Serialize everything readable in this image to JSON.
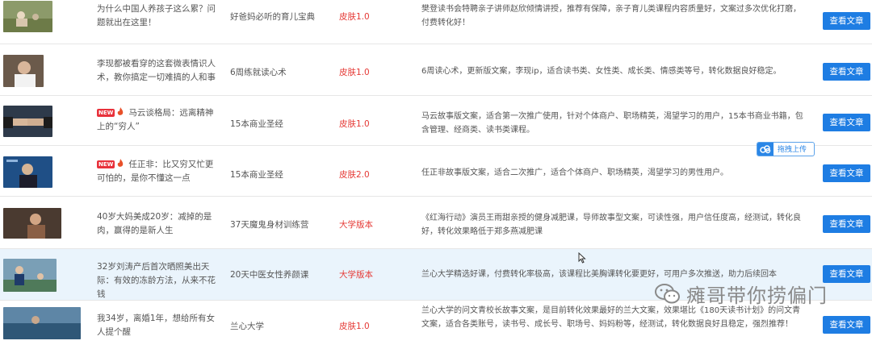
{
  "button_label": "查看文章",
  "upload_label": "拖拽上传",
  "watermark": "瘫哥带你捞偏门",
  "new_badge": "NEW",
  "rows": [
    {
      "title": "为什么中国人养孩子这么累？问题就出在这里！",
      "course": "好爸妈必听的育儿宝典",
      "skin": "皮肤1.0",
      "desc": "樊登读书会特聘亲子讲师赵欣倾情讲授，推荐有保障，亲子育儿类课程内容质量好，文案过多次优化打磨，付费转化好！"
    },
    {
      "title": "李现都被看穿的这套微表情识人术，教你搞定一切难搞的人和事",
      "course": "6周练就读心术",
      "skin": "皮肤1.0",
      "desc": "6周读心术，更新版文案，李现ip，适合读书类、女性类、成长类、情感类等号，转化数据良好稳定。"
    },
    {
      "title": "马云谈格局：远离精神上的“穷人”",
      "course": "15本商业圣经",
      "skin": "皮肤1.0",
      "desc": "马云故事版文案，适合第一次推广使用，针对个体商户、职场精英，渴望学习的用户，15本书商业书籍，包含管理、经商类、读书类课程。"
    },
    {
      "title": "任正非：比又穷又忙更可怕的，是你不懂这一点",
      "course": "15本商业圣经",
      "skin": "皮肤2.0",
      "desc": "任正非故事版文案，适合二次推广，适合个体商户、职场精英，渴望学习的男性用户。"
    },
    {
      "title": "40岁大妈美成20岁：减掉的是肉，赢得的是新人生",
      "course": "37天魔鬼身材训练营",
      "skin": "大学版本",
      "desc": "《红海行动》演员王雨甜亲授的健身减肥课，导师故事型文案，可读性强，用户信任度高，经测试，转化良好，转化效果略低于郑多燕减肥课"
    },
    {
      "title": "32岁刘涛产后首次晒照美出天际：有效的冻龄方法，从来不花钱",
      "course": "20天中医女性养颜课",
      "skin": "大学版本",
      "desc": "兰心大学精选好课，付费转化率极高，该课程比美胸课转化要更好，可用户多次推送，助力后续回本"
    },
    {
      "title": "我34岁，离婚1年，想给所有女人提个醒",
      "course": "兰心大学",
      "skin": "皮肤1.0",
      "desc": "兰心大学的问文青校长故事文案，是目前转化效果最好的兰大文案，效果堪比《180天读书计划》的问文青文案，适合各类账号，读书号、成长号、职场号、妈妈粉等，经测试，转化数据良好且稳定，强烈推荐！"
    }
  ]
}
